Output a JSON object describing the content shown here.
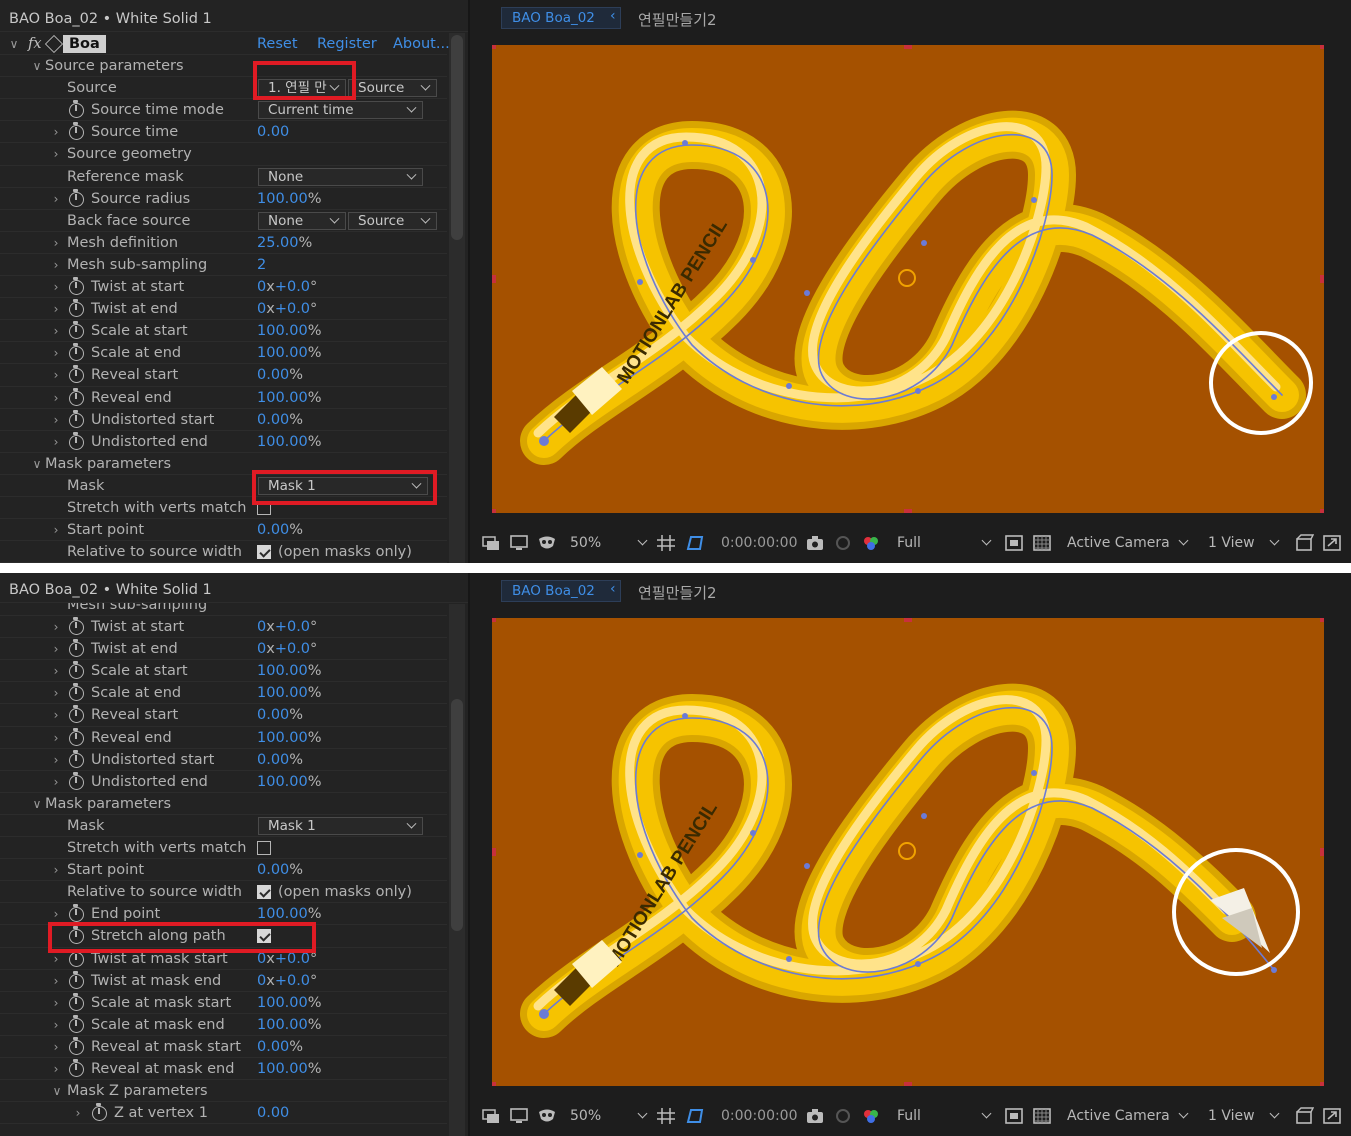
{
  "panelA": {
    "header": "BAO Boa_02 • White Solid 1",
    "effect": {
      "name": "Boa",
      "fx": "fx",
      "reset": "Reset",
      "register": "Register",
      "about": "About..."
    },
    "rows": [
      {
        "kind": "group",
        "twirl": "∨",
        "label": "Source parameters"
      },
      {
        "kind": "source",
        "label": "Source",
        "dd1": "1. 연필 만",
        "dd2": "Source"
      },
      {
        "kind": "dd",
        "sw": true,
        "label": "Source time mode",
        "dd": "Current time"
      },
      {
        "kind": "val",
        "twirl": "›",
        "sw": true,
        "label": "Source time",
        "value": "0.00",
        "unit": ""
      },
      {
        "kind": "lbl",
        "twirl": "›",
        "label": "Source geometry"
      },
      {
        "kind": "dd",
        "label": "Reference mask",
        "dd": "None"
      },
      {
        "kind": "val",
        "twirl": "›",
        "sw": true,
        "label": "Source radius",
        "value": "100.00",
        "unit": "%"
      },
      {
        "kind": "dd2",
        "label": "Back face source",
        "dd1": "None",
        "dd2": "Source"
      },
      {
        "kind": "val",
        "twirl": "›",
        "label": "Mesh definition",
        "value": "25.00",
        "unit": "%"
      },
      {
        "kind": "val",
        "twirl": "›",
        "label": "Mesh sub-sampling",
        "value": "2",
        "unit": ""
      },
      {
        "kind": "twist",
        "twirl": "›",
        "sw": true,
        "label": "Twist at start",
        "value": "0",
        "value2": "+0.0"
      },
      {
        "kind": "twist",
        "twirl": "›",
        "sw": true,
        "label": "Twist at end",
        "value": "0",
        "value2": "+0.0"
      },
      {
        "kind": "val",
        "twirl": "›",
        "sw": true,
        "label": "Scale at start",
        "value": "100.00",
        "unit": "%"
      },
      {
        "kind": "val",
        "twirl": "›",
        "sw": true,
        "label": "Scale at end",
        "value": "100.00",
        "unit": "%"
      },
      {
        "kind": "val",
        "twirl": "›",
        "sw": true,
        "label": "Reveal start",
        "value": "0.00",
        "unit": "%"
      },
      {
        "kind": "val",
        "twirl": "›",
        "sw": true,
        "label": "Reveal end",
        "value": "100.00",
        "unit": "%"
      },
      {
        "kind": "val",
        "twirl": "›",
        "sw": true,
        "label": "Undistorted start",
        "value": "0.00",
        "unit": "%"
      },
      {
        "kind": "val",
        "twirl": "›",
        "sw": true,
        "label": "Undistorted end",
        "value": "100.00",
        "unit": "%"
      },
      {
        "kind": "group",
        "twirl": "∨",
        "label": "Mask parameters"
      },
      {
        "kind": "ddwide",
        "label": "Mask",
        "dd": "Mask 1"
      },
      {
        "kind": "check",
        "label": "Stretch with verts match",
        "checked": false
      },
      {
        "kind": "val",
        "twirl": "›",
        "label": "Start point",
        "value": "0.00",
        "unit": "%"
      },
      {
        "kind": "check",
        "label": "Relative to source width",
        "checked": true,
        "text": "(open masks only)"
      }
    ]
  },
  "panelB": {
    "header": "BAO Boa_02 • White Solid 1",
    "rows": [
      {
        "kind": "lbl",
        "label": "Mesh sub-sampling"
      },
      {
        "kind": "twist",
        "twirl": "›",
        "sw": true,
        "label": "Twist at start",
        "value": "0",
        "value2": "+0.0"
      },
      {
        "kind": "twist",
        "twirl": "›",
        "sw": true,
        "label": "Twist at end",
        "value": "0",
        "value2": "+0.0"
      },
      {
        "kind": "val",
        "twirl": "›",
        "sw": true,
        "label": "Scale at start",
        "value": "100.00",
        "unit": "%"
      },
      {
        "kind": "val",
        "twirl": "›",
        "sw": true,
        "label": "Scale at end",
        "value": "100.00",
        "unit": "%"
      },
      {
        "kind": "val",
        "twirl": "›",
        "sw": true,
        "label": "Reveal start",
        "value": "0.00",
        "unit": "%"
      },
      {
        "kind": "val",
        "twirl": "›",
        "sw": true,
        "label": "Reveal end",
        "value": "100.00",
        "unit": "%"
      },
      {
        "kind": "val",
        "twirl": "›",
        "sw": true,
        "label": "Undistorted start",
        "value": "0.00",
        "unit": "%"
      },
      {
        "kind": "val",
        "twirl": "›",
        "sw": true,
        "label": "Undistorted end",
        "value": "100.00",
        "unit": "%"
      },
      {
        "kind": "group",
        "twirl": "∨",
        "label": "Mask parameters"
      },
      {
        "kind": "dd",
        "label": "Mask",
        "dd": "Mask 1"
      },
      {
        "kind": "check",
        "label": "Stretch with verts match",
        "checked": false
      },
      {
        "kind": "val",
        "twirl": "›",
        "label": "Start point",
        "value": "0.00",
        "unit": "%"
      },
      {
        "kind": "check",
        "label": "Relative to source width",
        "checked": true,
        "text": "(open masks only)"
      },
      {
        "kind": "val",
        "twirl": "›",
        "sw": true,
        "label": "End point",
        "value": "100.00",
        "unit": "%"
      },
      {
        "kind": "check",
        "sw": true,
        "label": "Stretch along path",
        "checked": true
      },
      {
        "kind": "twist",
        "twirl": "›",
        "sw": true,
        "label": "Twist at mask start",
        "value": "0",
        "value2": "+0.0"
      },
      {
        "kind": "twist",
        "twirl": "›",
        "sw": true,
        "label": "Twist at mask end",
        "value": "0",
        "value2": "+0.0"
      },
      {
        "kind": "val",
        "twirl": "›",
        "sw": true,
        "label": "Scale at mask start",
        "value": "100.00",
        "unit": "%"
      },
      {
        "kind": "val",
        "twirl": "›",
        "sw": true,
        "label": "Scale at mask end",
        "value": "100.00",
        "unit": "%"
      },
      {
        "kind": "val",
        "twirl": "›",
        "sw": true,
        "label": "Reveal at mask start",
        "value": "0.00",
        "unit": "%"
      },
      {
        "kind": "val",
        "twirl": "›",
        "sw": true,
        "label": "Reveal at mask end",
        "value": "100.00",
        "unit": "%"
      },
      {
        "kind": "group2",
        "twirl": "∨",
        "label": "Mask Z parameters"
      },
      {
        "kind": "zval",
        "twirl": "›",
        "sw": true,
        "label": "Z at vertex 1",
        "value": "0.00"
      }
    ]
  },
  "viewer": {
    "tab": "BAO Boa_02",
    "crumb": "연필만들기2",
    "pencil_text": "MOTIONLAB PENCIL",
    "zoom": "50%",
    "timecode": "0:00:00:00",
    "resolution": "Full",
    "camera": "Active Camera",
    "views": "1 View"
  },
  "colors": {
    "background": "#a55100",
    "accent_blue": "#3f8ee6",
    "highlight_red": "#e01b24",
    "pencil_yellow": "#f6c300",
    "pencil_light": "#ffe38a"
  }
}
